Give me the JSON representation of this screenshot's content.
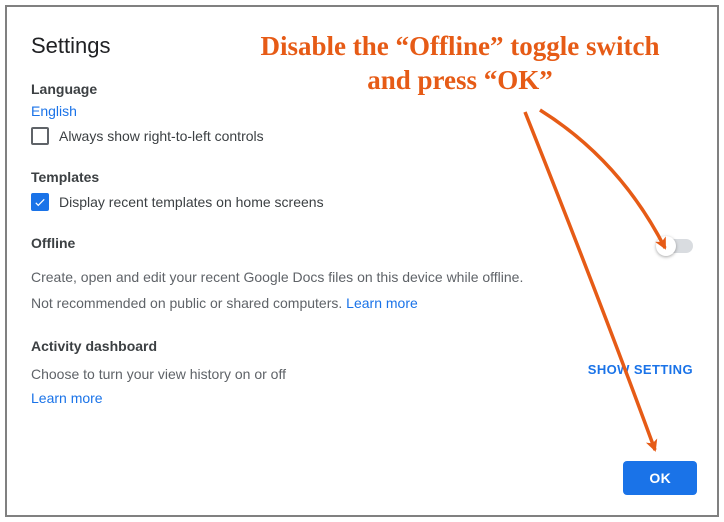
{
  "title": "Settings",
  "language": {
    "heading": "Language",
    "value": "English",
    "rtl_checkbox_label": "Always show right-to-left controls",
    "rtl_checked": false
  },
  "templates": {
    "heading": "Templates",
    "checkbox_label": "Display recent templates on home screens",
    "checked": true
  },
  "offline": {
    "heading": "Offline",
    "description": "Create, open and edit your recent Google Docs files on this device while offline.",
    "warning": "Not recommended on public or shared computers. ",
    "learn_more": "Learn more",
    "enabled": false
  },
  "activity": {
    "heading": "Activity dashboard",
    "description": "Choose to turn your view history on or off",
    "learn_more": "Learn more",
    "show_setting_label": "SHOW SETTING"
  },
  "ok_label": "OK",
  "annotation": {
    "text": "Disable the “Offline” toggle switch and press “OK”"
  }
}
